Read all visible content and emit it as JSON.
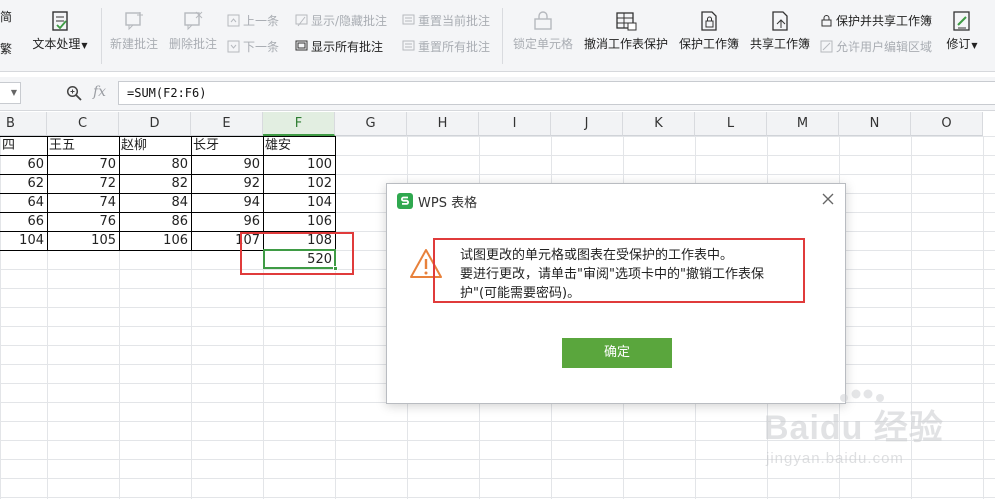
{
  "ribbon": {
    "col0_top": "简",
    "col0_bottom": "繁",
    "text_process": "文本处理",
    "new_comment": "新建批注",
    "delete_comment": "删除批注",
    "prev_item": "上一条",
    "next_item": "下一条",
    "show_hide_comment": "显示/隐藏批注",
    "show_all_comments": "显示所有批注",
    "reset_current_comment": "重置当前批注",
    "reset_all_comments": "重置所有批注",
    "lock_cell": "锁定单元格",
    "unprotect_sheet": "撤消工作表保护",
    "protect_workbook": "保护工作簿",
    "share_workbook": "共享工作簿",
    "protect_and_share": "保护并共享工作簿",
    "allow_edit_ranges": "允许用户编辑区域",
    "track_changes": "修订"
  },
  "formula_bar": {
    "fx": "fx",
    "formula": "=SUM(F2:F6)"
  },
  "columns": [
    "B",
    "C",
    "D",
    "E",
    "F",
    "G",
    "H",
    "I",
    "J",
    "K",
    "L",
    "M",
    "N",
    "O"
  ],
  "table": {
    "headers": [
      "四",
      "王五",
      "赵柳",
      "长牙",
      "雄安"
    ],
    "rows": [
      [
        "60",
        "70",
        "80",
        "90",
        "100"
      ],
      [
        "62",
        "72",
        "82",
        "92",
        "102"
      ],
      [
        "64",
        "74",
        "84",
        "94",
        "104"
      ],
      [
        "66",
        "76",
        "86",
        "96",
        "106"
      ],
      [
        "104",
        "105",
        "106",
        "107",
        "108"
      ]
    ],
    "sum_value": "520"
  },
  "dialog": {
    "title": "WPS 表格",
    "message_line1": "试图更改的单元格或图表在受保护的工作表中。",
    "message_line2": "要进行更改，请单击\"审阅\"选项卡中的\"撤销工作表保",
    "message_line3": "护\"(可能需要密码)。",
    "ok_label": "确定"
  },
  "watermark": {
    "brand": "Baidu 经验",
    "url": "jingyan.baidu.com"
  },
  "colors": {
    "accent_green": "#3f9b45",
    "ok_button": "#5aa63d",
    "highlight_red": "#e03b3b",
    "warning_orange": "#e8813b"
  }
}
